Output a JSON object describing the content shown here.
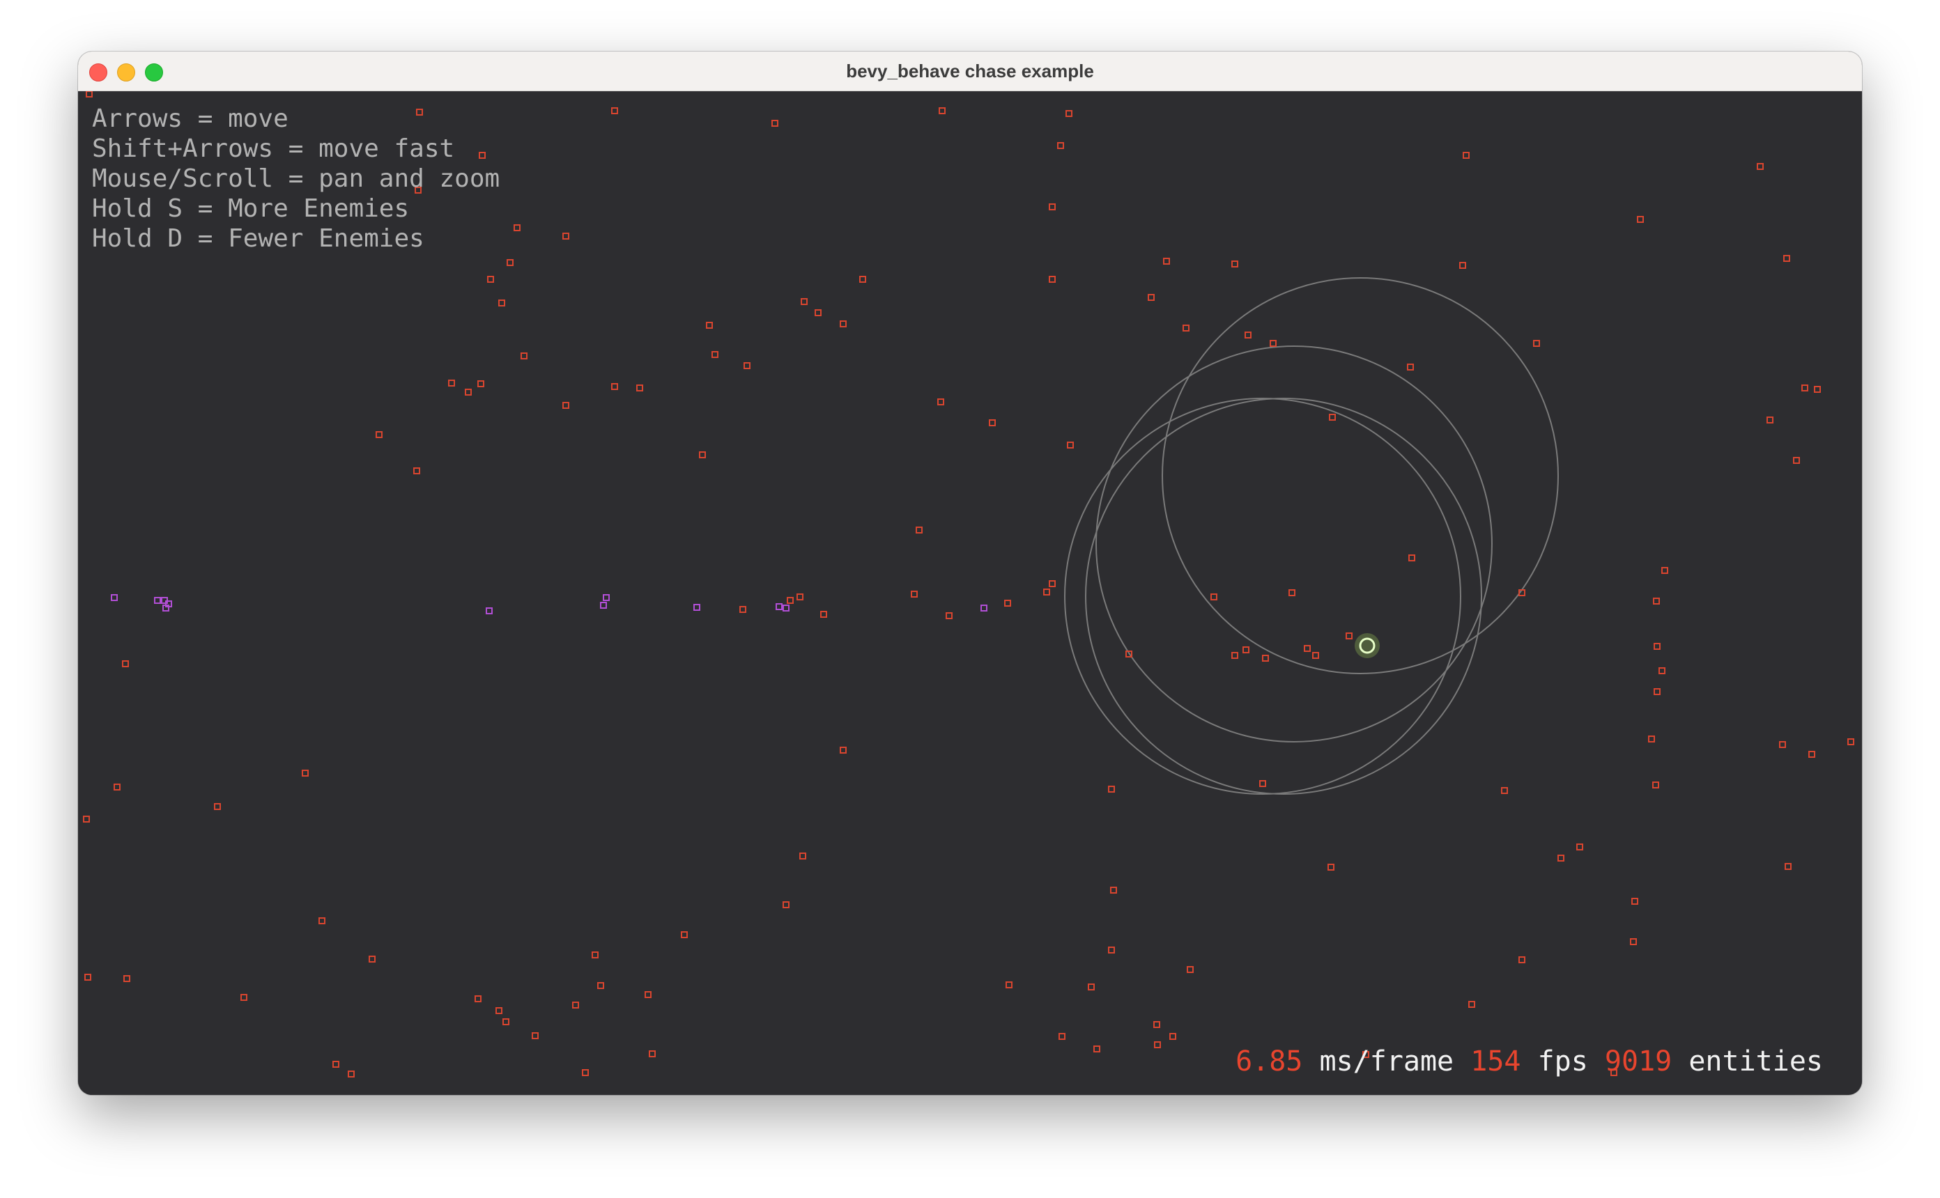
{
  "window": {
    "title": "bevy_behave chase example",
    "controls": [
      "close",
      "minimize",
      "zoom"
    ]
  },
  "help_text": [
    "Arrows = move",
    "Shift+Arrows = move fast",
    "Mouse/Scroll = pan and zoom",
    "Hold S = More Enemies",
    "Hold D = Fewer Enemies"
  ],
  "stats": {
    "ms_per_frame": "6.85",
    "ms_label": "ms/frame",
    "fps": "154",
    "fps_label": "fps",
    "entities": "9019",
    "entities_label": "entities"
  },
  "colors": {
    "background": "#2d2d30",
    "enemy": "#d9452f",
    "chasing_enemy": "#b24fd6",
    "player": "#b8f060",
    "detection_ring": "#7a7a7a",
    "stat_value": "#e8452e"
  }
}
